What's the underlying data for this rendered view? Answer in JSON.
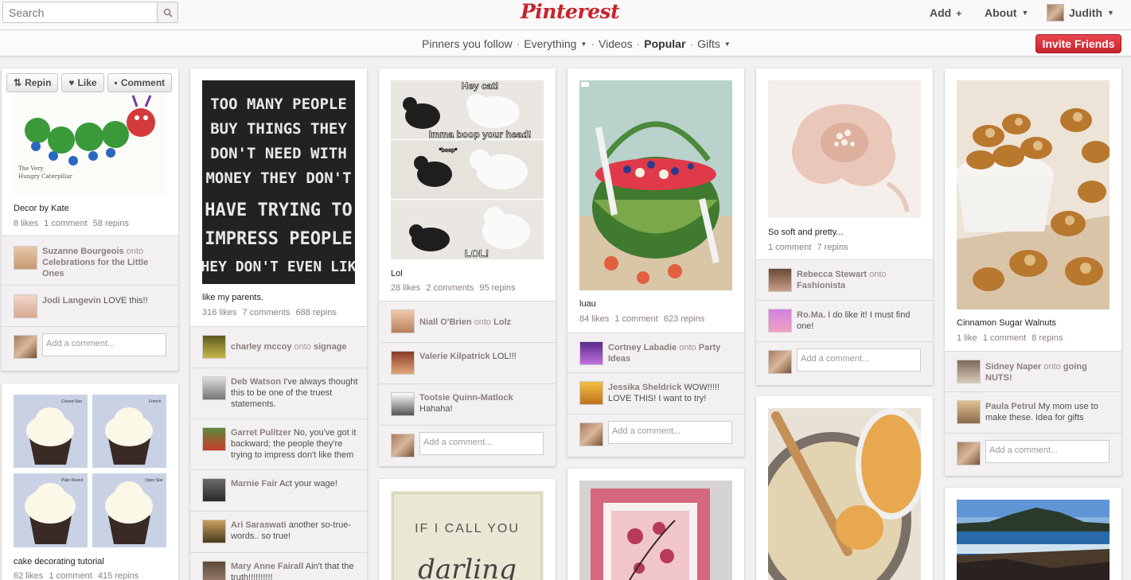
{
  "header": {
    "search_placeholder": "Search",
    "logo": "Pinterest",
    "add_label": "Add",
    "add_icon": "+",
    "about_label": "About",
    "user_name": "Judith"
  },
  "subnav": {
    "items": [
      "Pinners you follow",
      "Everything",
      "Videos",
      "Popular",
      "Gifts"
    ],
    "invite_label": "Invite Friends"
  },
  "pin_actions": {
    "repin": "Repin",
    "like": "Like",
    "comment": "Comment"
  },
  "add_comment_placeholder": "Add a comment...",
  "pins": [
    {
      "desc": "Decor by Kate",
      "likes": "8 likes",
      "comments": "1 comment",
      "repins": "58 repins",
      "activity": [
        {
          "user": "Suzanne Bourgeois",
          "onto": "onto",
          "board": "Celebrations for the Little Ones"
        },
        {
          "user": "Jodi Langevin",
          "text": "LOVE this!!"
        }
      ]
    },
    {
      "desc": "cake decorating tutorial",
      "likes": "62 likes",
      "comments": "1 comment",
      "repins": "415 repins",
      "image_labels": [
        "Closed Star",
        "French",
        "Plain Round",
        "Open Star"
      ]
    },
    {
      "desc": "like my parents.",
      "likes": "316 likes",
      "comments": "7 comments",
      "repins": "688 repins",
      "image_text": [
        "TOO MANY PEOPLE",
        "BUY THINGS THEY",
        "DON'T NEED WITH",
        "MONEY THEY DON'T",
        "HAVE TRYING TO",
        "IMPRESS PEOPLE",
        "THEY DON'T EVEN LIKE"
      ],
      "activity": [
        {
          "user": "charley mccoy",
          "onto": "onto",
          "board": "signage"
        },
        {
          "user": "Deb Watson",
          "text": "I've always thought this to be one of the truest statements."
        },
        {
          "user": "Garret Pulitzer",
          "text": "No, you've got it backward; the people they're trying to impress don't like them"
        },
        {
          "user": "Marnie Fair",
          "text": "Act your wage!"
        },
        {
          "user": "Ari Saraswati",
          "text": "another so-true-words.. so true!"
        },
        {
          "user": "Mary Anne Fairall",
          "text": "Ain't that the truth!!!!!!!!!!"
        }
      ]
    },
    {
      "desc": "Lol",
      "likes": "28 likes",
      "comments": "2 comments",
      "repins": "95 repins",
      "image_text": [
        "Hey cat!",
        "Imma boop your head!",
        "*boop*",
        "LOL!"
      ],
      "activity": [
        {
          "user": "Niall O'Brien",
          "onto": "onto",
          "board": "Lolz"
        },
        {
          "user": "Valerie Kilpatrick",
          "text": "LOL!!!"
        },
        {
          "user": "Tootsie Quinn-Matlock",
          "text": "Hahaha!"
        }
      ]
    },
    {
      "image_text": [
        "IF I CALL YOU",
        "darling"
      ]
    },
    {
      "desc": "luau",
      "likes": "84 likes",
      "comments": "1 comment",
      "repins": "623 repins",
      "activity": [
        {
          "user": "Cortney Labadie",
          "onto": "onto",
          "board": "Party Ideas"
        },
        {
          "user": "Jessika Sheldrick",
          "text": "WOW!!!!! LOVE THIS! I want to try!"
        }
      ]
    },
    {
      "desc": "So soft and pretty...",
      "comments": "1 comment",
      "repins": "7 repins",
      "activity": [
        {
          "user": "Rebecca Stewart",
          "onto": "onto",
          "board": "Fashionista"
        },
        {
          "user": "Ro.Ma.",
          "text": "I do like it! I must find one!"
        }
      ]
    },
    {
      "desc": "Cinnamon Sugar Walnuts",
      "likes": "1 like",
      "comments": "1 comment",
      "repins": "8 repins",
      "activity": [
        {
          "user": "Sidney Naper",
          "onto": "onto",
          "board": "going NUTS!"
        },
        {
          "user": "Paula Petrul",
          "text": "My mom use to make these. Idea for gifts"
        }
      ]
    }
  ]
}
